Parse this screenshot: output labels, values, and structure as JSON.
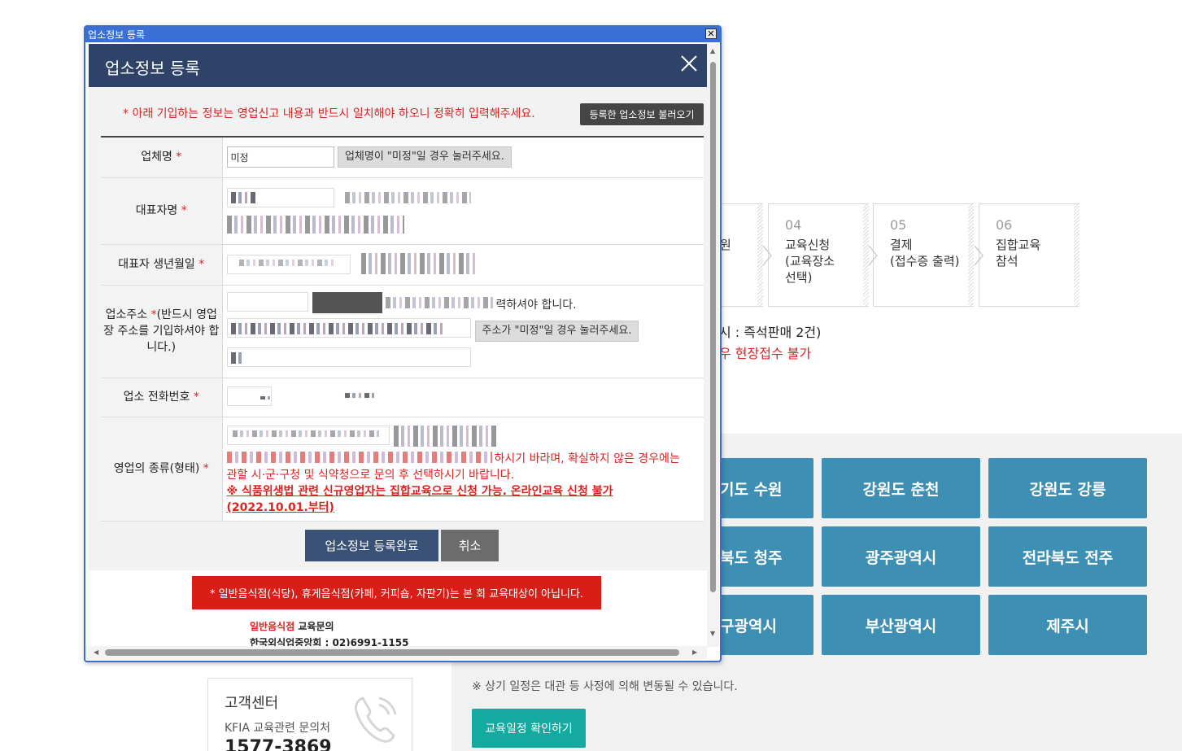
{
  "steps": [
    {
      "num": "",
      "label": "원"
    },
    {
      "num": "04",
      "label": "교육신청\n(교육장소\n선택)"
    },
    {
      "num": "05",
      "label": "결제\n(접수증 출력)"
    },
    {
      "num": "06",
      "label": "집합교육\n참석"
    }
  ],
  "bg_notes": {
    "note1": "시 : 즉석판매 2건)",
    "note2": "우 현장접수 불가"
  },
  "regions": [
    "기도 수원",
    "강원도 춘천",
    "강원도 강릉",
    "북도 청주",
    "광주광역시",
    "전라북도 전주",
    "구광역시",
    "부산광역시",
    "제주시"
  ],
  "schedule_notice": "※ 상기 일정은 대관 등 사정에 의해 변동될 수 있습니다.",
  "schedule_button": "교육일정 확인하기",
  "customer_center": {
    "title": "고객센터",
    "subtitle": "KFIA 교육관련 문의처",
    "phone": "1577-3869"
  },
  "window": {
    "title": "업소정보 등록",
    "close": "✕"
  },
  "dialog": {
    "title": "업소정보 등록",
    "warning": "* 아래 기입하는 정보는 영업신고 내용과 반드시 일치해야 하오니 정확히 입력해주세요.",
    "load_button": "등록한 업소정보 불러오기",
    "fields": {
      "business_name": {
        "label": "업체명",
        "value": "미정",
        "button": "업체명이 \"미정\"일 경우 눌러주세요."
      },
      "representative": {
        "label": "대표자명"
      },
      "birthdate": {
        "label": "대표자 생년월일"
      },
      "address": {
        "label": "업소주소",
        "label_note": "(반드시 영업장 주소를 기입하셔야 합니다.)",
        "tail_text": "력하셔야 합니다.",
        "button": "주소가 \"미정\"일 경우 눌러주세요."
      },
      "phone": {
        "label": "업소 전화번호"
      },
      "business_type": {
        "label": "영업의 종류(형태)",
        "help1": "하시기 바라며, 확실하지 않은 경우에는",
        "help2": "관할 시·군·구청 및 식약청으로 문의 후 선택하시기 바랍니다.",
        "notice": "※ 식품위생법 관련 신규영업자는 집합교육으로 신청 가능. 온라인교육 신청 불가 (2022.10.01.부터)"
      }
    },
    "required_mark": "*",
    "submit_button": "업소정보 등록완료",
    "cancel_button": "취소",
    "banner": "* 일반음식점(식당), 휴게음식점(카페, 커피숍, 자판기)는 본 회 교육대상이 아닙니다.",
    "contact": {
      "keyword": "일반음식점",
      "label": " 교육문의",
      "org_phone": "한국외식업중앙회 : 02)6991-1155"
    }
  }
}
